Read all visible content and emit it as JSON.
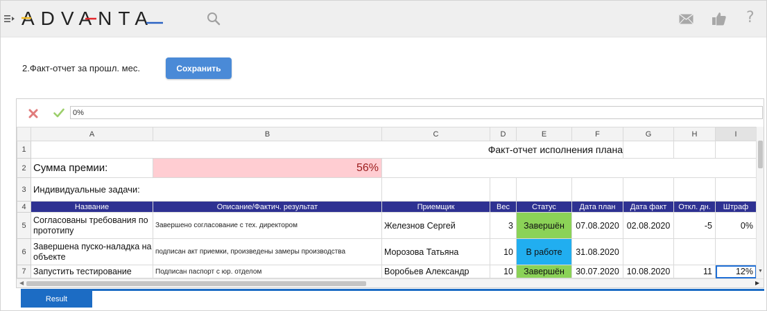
{
  "header": {
    "brand": "ADVANTA",
    "brand_colors": {
      "text": "#222222",
      "accent_red": "#e2262b",
      "accent_yellow": "#f0b81c",
      "accent_blue": "#2a63c4"
    }
  },
  "page": {
    "title": "2.Факт-отчет за прошл. мес.",
    "save_label": "Сохранить"
  },
  "formula_bar": {
    "value": "0%"
  },
  "grid": {
    "columns": [
      "A",
      "B",
      "C",
      "D",
      "E",
      "F",
      "G",
      "H",
      "I"
    ],
    "row_numbers": [
      "1",
      "2",
      "3",
      "4",
      "5",
      "6",
      "7"
    ],
    "report_title": "Факт-отчет исполнения плана",
    "bonus_label": "Сумма премии:",
    "bonus_value": "56%",
    "tasks_label": "Индивидуальные задачи:",
    "table_headers": [
      "Название",
      "Описание/Фактич. результат",
      "Приемщик",
      "Вес",
      "Статус",
      "Дата план",
      "Дата факт",
      "Откл. дн.",
      "Штраф"
    ],
    "rows": [
      {
        "name": "Согласованы требования по прототипу",
        "desc": "Завершено согласование с тех. директором",
        "receiver": "Железнов Сергей",
        "weight": "3",
        "status": "Завершён",
        "plan": "07.08.2020",
        "fact": "02.08.2020",
        "dev": "-5",
        "fine": "0%"
      },
      {
        "name": "Завершена пуско-наладка на объекте",
        "desc": "подписан акт приемки, произведены замеры производства",
        "receiver": "Морозова Татьяна",
        "weight": "10",
        "status": "В работе",
        "plan": "31.08.2020",
        "fact": "",
        "dev": "",
        "fine": ""
      },
      {
        "name": "Запустить тестирование",
        "desc": "Подписан паспорт с юр. отделом",
        "receiver": "Воробьев Александр",
        "weight": "10",
        "status": "Завершён",
        "plan": "30.07.2020",
        "fact": "10.08.2020",
        "dev": "11",
        "fine": "12%"
      }
    ],
    "colors": {
      "header_bg": "#2e3192",
      "bonus_bg": "#ffcdd2",
      "bonus_text": "#9b1c1c",
      "status_done": "#8bd257",
      "status_work": "#21aef0"
    }
  },
  "tabs": {
    "result_label": "Result"
  },
  "icons": [
    "menu-icon",
    "search-icon",
    "mail-icon",
    "like-icon",
    "help-icon",
    "cancel-icon",
    "confirm-icon"
  ],
  "help_glyph": "?"
}
